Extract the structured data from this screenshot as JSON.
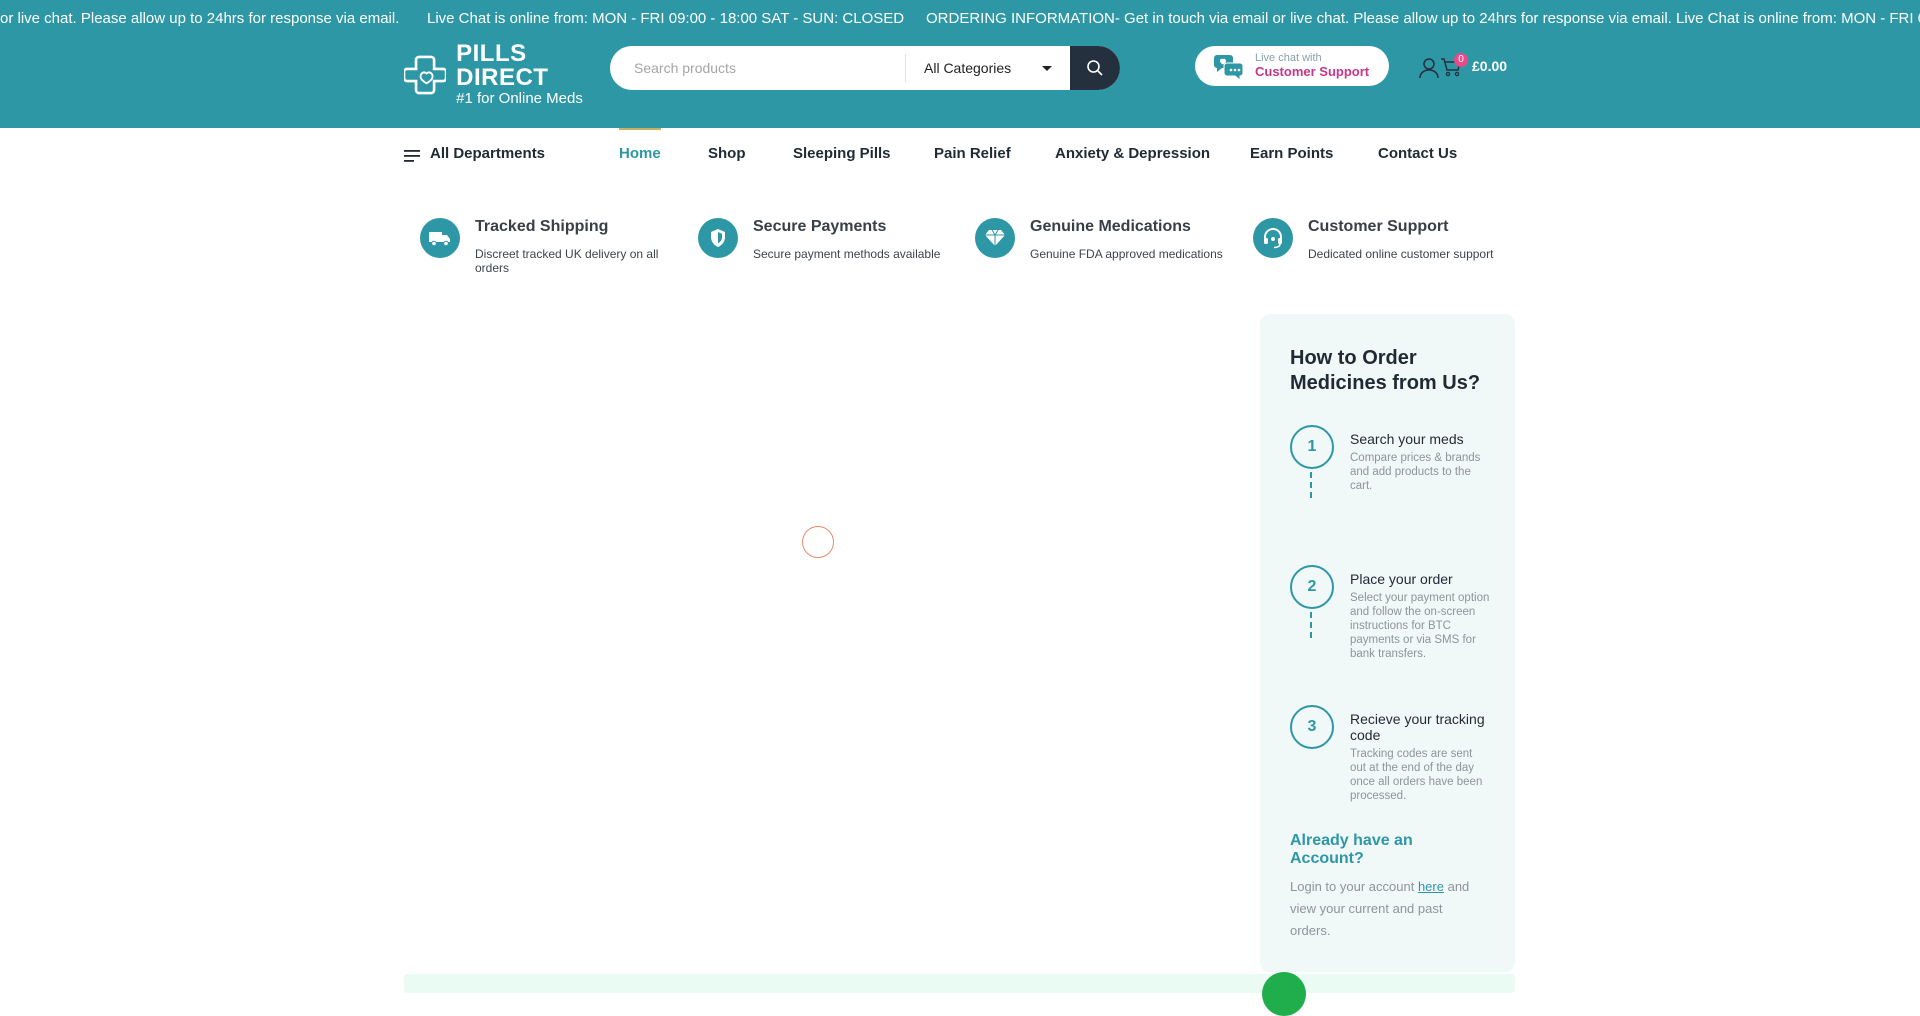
{
  "ticker": {
    "part1": "or live chat. Please allow up to 24hrs for response via email.",
    "part2": "Live Chat is online from: MON - FRI 09:00 - 18:00 SAT - SUN: CLOSED",
    "part3": "ORDERING INFORMATION- Get in touch via email or live chat. Please allow up to 24hrs for response via email.",
    "part4": "Live Chat is online from: MON - FRI 09:"
  },
  "logo": {
    "title": "PILLS DIRECT",
    "subtitle": "#1 for Online Meds"
  },
  "search": {
    "placeholder": "Search products",
    "category": "All Categories",
    "icon": "search-icon"
  },
  "chat": {
    "line1": "Live chat with",
    "line2": "Customer Support"
  },
  "cart": {
    "count": "0",
    "total": "£0.00"
  },
  "nav": {
    "departments": "All Departments",
    "items": [
      "Home",
      "Shop",
      "Sleeping Pills",
      "Pain Relief",
      "Anxiety & Depression",
      "Earn Points",
      "Contact Us"
    ]
  },
  "features": [
    {
      "title": "Tracked Shipping",
      "desc": "Discreet tracked UK delivery on all orders",
      "icon": "truck-icon"
    },
    {
      "title": "Secure Payments",
      "desc": "Secure payment methods available",
      "icon": "shield-icon"
    },
    {
      "title": "Genuine Medications",
      "desc": "Genuine FDA approved medications",
      "icon": "diamond-icon"
    },
    {
      "title": "Customer Support",
      "desc": "Dedicated online customer support",
      "icon": "headset-icon"
    }
  ],
  "sidebar": {
    "title": "How to Order Medicines from Us?",
    "steps": [
      {
        "num": "1",
        "title": "Search your meds",
        "desc": "Compare prices & brands and add products to the cart."
      },
      {
        "num": "2",
        "title": "Place your order",
        "desc": "Select your payment option and follow the on-screen instructions for BTC payments or via SMS for bank transfers."
      },
      {
        "num": "3",
        "title": "Recieve your tracking code",
        "desc": "Tracking codes are sent out at the end of the day once all orders have been processed."
      }
    ],
    "account_title": "Already have an Account?",
    "account_pre": "Login to your account",
    "account_link": "here",
    "account_post": "and view your current and past orders."
  },
  "colors": {
    "brand": "#2e97a6",
    "accent_pink": "#c4378a",
    "nav_active_underline": "#c9b062"
  }
}
